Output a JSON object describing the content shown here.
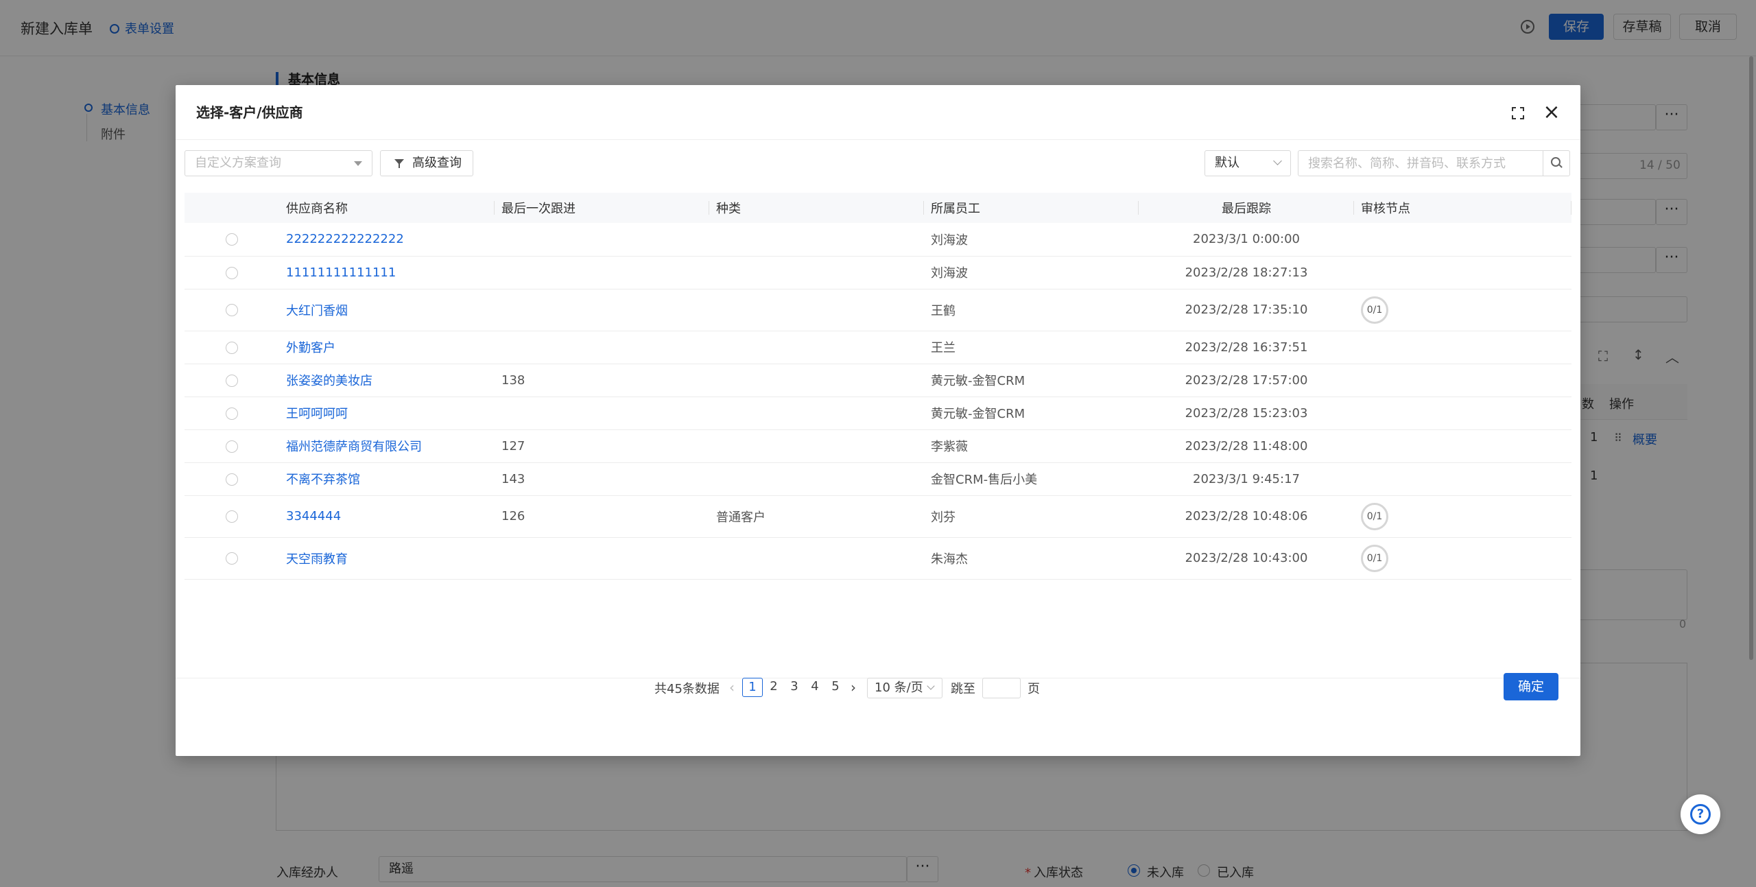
{
  "page": {
    "title": "新建入库单",
    "form_settings": "表单设置",
    "buttons": {
      "save": "保存",
      "draft": "存草稿",
      "cancel": "取消"
    },
    "nav": {
      "basic_info": "基本信息",
      "attachment": "附件"
    },
    "section_title": "基本信息",
    "char_count": "14 / 50",
    "dots": "···",
    "table_header_qty": "数",
    "table_header_op": "操作",
    "overview_link": "概要",
    "row_numbers": [
      "1",
      "1"
    ],
    "amount_zero": "0",
    "handler_label": "入库经办人",
    "handler_value": "路遥",
    "status_label": "入库状态",
    "status_options": [
      "未入库",
      "已入库"
    ],
    "status_selected": "未入库",
    "help": "?"
  },
  "modal": {
    "title": "选择-客户/供应商",
    "icons": {
      "expand": "expand-icon",
      "close": "close-icon",
      "search": "search-icon",
      "filter": "filter-icon"
    },
    "scheme_placeholder": "自定义方案查询",
    "advanced_query": "高级查询",
    "sort_value": "默认",
    "search_placeholder": "搜索名称、简称、拼音码、联系方式",
    "columns": [
      "供应商名称",
      "最后一次跟进",
      "种类",
      "所属员工",
      "最后跟踪",
      "审核节点"
    ],
    "rows": [
      {
        "name": "222222222222222",
        "last_follow": "",
        "type": "",
        "staff": "刘海波",
        "last_track": "2023/3/1 0:00:00",
        "audit": ""
      },
      {
        "name": "11111111111111",
        "last_follow": "",
        "type": "",
        "staff": "刘海波",
        "last_track": "2023/2/28 18:27:13",
        "audit": ""
      },
      {
        "name": "大红门香烟",
        "last_follow": "",
        "type": "",
        "staff": "王鹤",
        "last_track": "2023/2/28 17:35:10",
        "audit": "0/1"
      },
      {
        "name": "外勤客户",
        "last_follow": "",
        "type": "",
        "staff": "王兰",
        "last_track": "2023/2/28 16:37:51",
        "audit": ""
      },
      {
        "name": "张姿姿的美妆店",
        "last_follow": "138",
        "type": "",
        "staff": "黄元敏-金智CRM",
        "last_track": "2023/2/28 17:57:00",
        "audit": ""
      },
      {
        "name": "王呵呵呵呵",
        "last_follow": "",
        "type": "",
        "staff": "黄元敏-金智CRM",
        "last_track": "2023/2/28 15:23:03",
        "audit": ""
      },
      {
        "name": "福州范德萨商贸有限公司",
        "last_follow": "127",
        "type": "",
        "staff": "李紫薇",
        "last_track": "2023/2/28 11:48:00",
        "audit": ""
      },
      {
        "name": "不离不弃茶馆",
        "last_follow": "143",
        "type": "",
        "staff": "金智CRM-售后小美",
        "last_track": "2023/3/1 9:45:17",
        "audit": ""
      },
      {
        "name": "3344444",
        "last_follow": "126",
        "type": "普通客户",
        "staff": "刘芬",
        "last_track": "2023/2/28 10:48:06",
        "audit": "0/1"
      },
      {
        "name": "天空雨教育",
        "last_follow": "",
        "type": "",
        "staff": "朱海杰",
        "last_track": "2023/2/28 10:43:00",
        "audit": "0/1"
      }
    ],
    "pagination": {
      "total": "共45条数据",
      "pages": [
        "1",
        "2",
        "3",
        "4",
        "5"
      ],
      "current": "1",
      "page_size": "10 条/页",
      "jump_label": "跳至",
      "page_unit": "页"
    },
    "confirm": "确定"
  },
  "colors": {
    "primary": "#1a66d8",
    "mask": "rgba(0,0,0,0.45)"
  }
}
